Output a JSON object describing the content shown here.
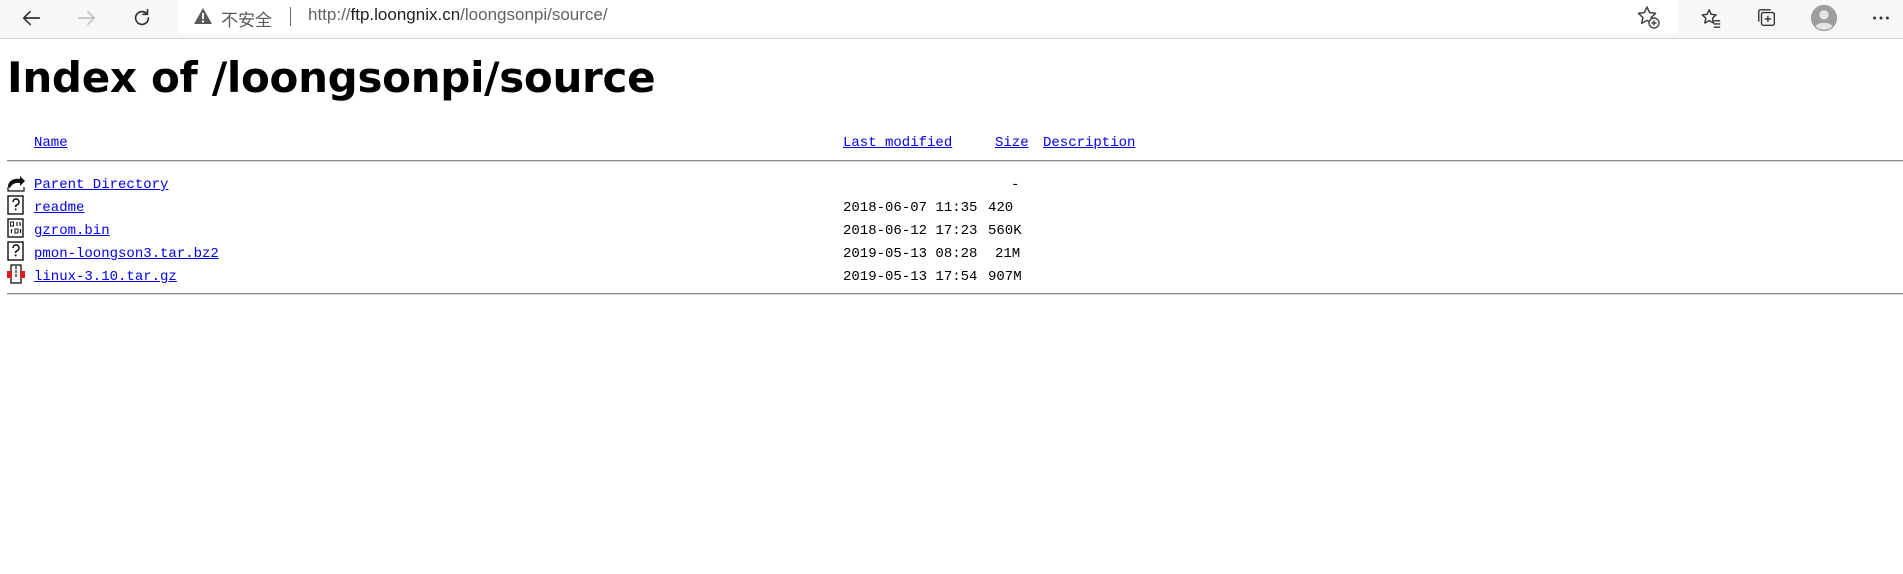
{
  "browser": {
    "security_label": "不安全",
    "url_scheme": "http://",
    "url_host": "ftp.loongnix.cn",
    "url_path": "/loongsonpi/source/"
  },
  "page": {
    "title": "Index of /loongsonpi/source",
    "columns": {
      "name": "Name",
      "last_modified": "Last modified",
      "size": "Size",
      "description": "Description"
    },
    "rows": [
      {
        "icon": "parent-directory-icon",
        "name": "Parent Directory",
        "modified": "",
        "size": "-"
      },
      {
        "icon": "unknown-file-icon",
        "name": "readme",
        "modified": "2018-06-07 11:35",
        "size": "420"
      },
      {
        "icon": "binary-file-icon",
        "name": "gzrom.bin",
        "modified": "2018-06-12 17:23",
        "size": "560K"
      },
      {
        "icon": "unknown-file-icon",
        "name": "pmon-loongson3.tar.bz2",
        "modified": "2019-05-13 08:28",
        "size": "21M"
      },
      {
        "icon": "compressed-file-icon",
        "name": "linux-3.10.tar.gz",
        "modified": "2019-05-13 17:54",
        "size": "907M"
      }
    ]
  }
}
